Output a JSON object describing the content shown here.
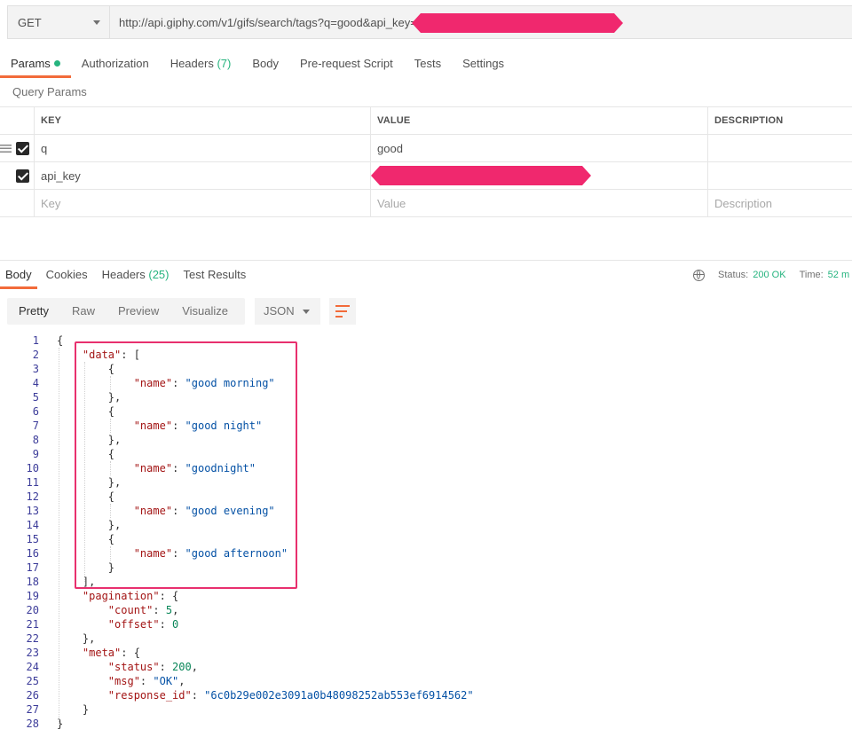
{
  "request": {
    "method": "GET",
    "url": "http://api.giphy.com/v1/gifs/search/tags?q=good&api_key="
  },
  "request_tabs": [
    {
      "label": "Params",
      "active": true,
      "dot": true
    },
    {
      "label": "Authorization"
    },
    {
      "label": "Headers",
      "count": "(7)"
    },
    {
      "label": "Body"
    },
    {
      "label": "Pre-request Script"
    },
    {
      "label": "Tests"
    },
    {
      "label": "Settings"
    }
  ],
  "query_params": {
    "title": "Query Params",
    "headers": {
      "key": "KEY",
      "value": "VALUE",
      "description": "DESCRIPTION"
    },
    "rows": [
      {
        "key": "q",
        "value": "good",
        "checked": true
      },
      {
        "key": "api_key",
        "value": "",
        "checked": true,
        "redacted": true
      }
    ],
    "placeholders": {
      "key": "Key",
      "value": "Value",
      "description": "Description"
    }
  },
  "response_tabs": [
    {
      "label": "Body",
      "active": true
    },
    {
      "label": "Cookies"
    },
    {
      "label": "Headers",
      "count": "(25)"
    },
    {
      "label": "Test Results"
    }
  ],
  "response_status": {
    "status_label": "Status:",
    "status_value": "200 OK",
    "time_label": "Time:",
    "time_value": "52 m"
  },
  "view_modes": [
    "Pretty",
    "Raw",
    "Preview",
    "Visualize"
  ],
  "active_view": "Pretty",
  "format": "JSON",
  "icons": {
    "wrap": "wrap-lines-icon",
    "globe": "globe-icon",
    "handle": "drag-handle-icon",
    "check": "checkbox-checked-icon"
  },
  "colors": {
    "accent": "#f26b3a",
    "success": "#26b47f",
    "highlight": "#e8306e",
    "redaction": "#f0286e"
  },
  "code_lines": [
    [
      [
        "p",
        "{"
      ]
    ],
    [
      [
        "p",
        "    "
      ],
      [
        "k",
        "\"data\""
      ],
      [
        "p",
        ": ["
      ]
    ],
    [
      [
        "p",
        "        {"
      ]
    ],
    [
      [
        "p",
        "            "
      ],
      [
        "k",
        "\"name\""
      ],
      [
        "p",
        ": "
      ],
      [
        "s",
        "\"good morning\""
      ]
    ],
    [
      [
        "p",
        "        },"
      ]
    ],
    [
      [
        "p",
        "        {"
      ]
    ],
    [
      [
        "p",
        "            "
      ],
      [
        "k",
        "\"name\""
      ],
      [
        "p",
        ": "
      ],
      [
        "s",
        "\"good night\""
      ]
    ],
    [
      [
        "p",
        "        },"
      ]
    ],
    [
      [
        "p",
        "        {"
      ]
    ],
    [
      [
        "p",
        "            "
      ],
      [
        "k",
        "\"name\""
      ],
      [
        "p",
        ": "
      ],
      [
        "s",
        "\"goodnight\""
      ]
    ],
    [
      [
        "p",
        "        },"
      ]
    ],
    [
      [
        "p",
        "        {"
      ]
    ],
    [
      [
        "p",
        "            "
      ],
      [
        "k",
        "\"name\""
      ],
      [
        "p",
        ": "
      ],
      [
        "s",
        "\"good evening\""
      ]
    ],
    [
      [
        "p",
        "        },"
      ]
    ],
    [
      [
        "p",
        "        {"
      ]
    ],
    [
      [
        "p",
        "            "
      ],
      [
        "k",
        "\"name\""
      ],
      [
        "p",
        ": "
      ],
      [
        "s",
        "\"good afternoon\""
      ]
    ],
    [
      [
        "p",
        "        }"
      ]
    ],
    [
      [
        "p",
        "    ],"
      ]
    ],
    [
      [
        "p",
        "    "
      ],
      [
        "k",
        "\"pagination\""
      ],
      [
        "p",
        ": {"
      ]
    ],
    [
      [
        "p",
        "        "
      ],
      [
        "k",
        "\"count\""
      ],
      [
        "p",
        ": "
      ],
      [
        "n",
        "5"
      ],
      [
        "p",
        ","
      ]
    ],
    [
      [
        "p",
        "        "
      ],
      [
        "k",
        "\"offset\""
      ],
      [
        "p",
        ": "
      ],
      [
        "n",
        "0"
      ]
    ],
    [
      [
        "p",
        "    },"
      ]
    ],
    [
      [
        "p",
        "    "
      ],
      [
        "k",
        "\"meta\""
      ],
      [
        "p",
        ": {"
      ]
    ],
    [
      [
        "p",
        "        "
      ],
      [
        "k",
        "\"status\""
      ],
      [
        "p",
        ": "
      ],
      [
        "n",
        "200"
      ],
      [
        "p",
        ","
      ]
    ],
    [
      [
        "p",
        "        "
      ],
      [
        "k",
        "\"msg\""
      ],
      [
        "p",
        ": "
      ],
      [
        "s",
        "\"OK\""
      ],
      [
        "p",
        ","
      ]
    ],
    [
      [
        "p",
        "        "
      ],
      [
        "k",
        "\"response_id\""
      ],
      [
        "p",
        ": "
      ],
      [
        "s",
        "\"6c0b29e002e3091a0b48098252ab553ef6914562\""
      ]
    ],
    [
      [
        "p",
        "    }"
      ]
    ],
    [
      [
        "p",
        "}"
      ]
    ]
  ]
}
